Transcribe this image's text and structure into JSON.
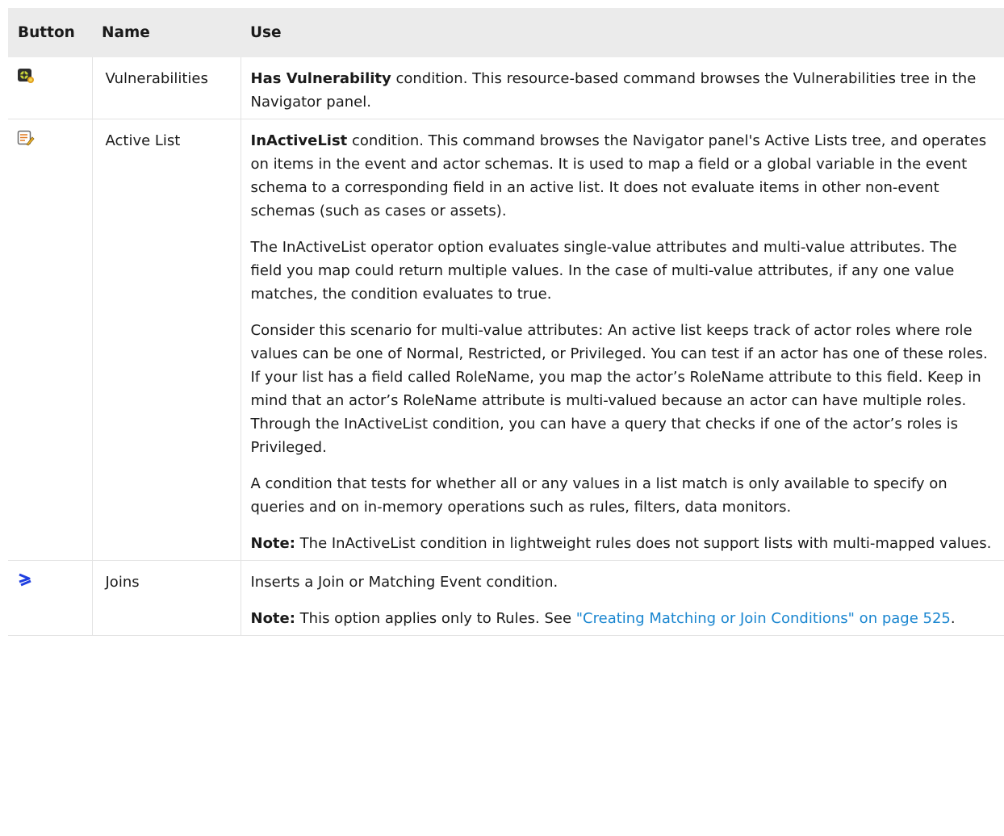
{
  "headers": {
    "button": "Button",
    "name": "Name",
    "use": "Use"
  },
  "rows": [
    {
      "icon": "vulnerability-icon",
      "name": "Vulnerabilities",
      "use": {
        "p1_bold": "Has Vulnerability",
        "p1_rest": " condition. This resource-based command browses the Vulnerabilities tree in the Navigator panel."
      }
    },
    {
      "icon": "active-list-icon",
      "name": "Active List",
      "use": {
        "p1_bold": "InActiveList",
        "p1_rest": " condition. This command browses the Navigator panel's Active Lists tree, and operates on items in the event and actor schemas. It is used to map a field or a global variable in the event schema to a corresponding field in an active list. It does not evaluate items in other non-event schemas (such as cases or assets).",
        "p2": "The InActiveList operator option evaluates single-value attributes and multi-value attributes. The field you map could return multiple values. In the case of multi-value attributes, if any one value matches, the condition evaluates to true.",
        "p3": "Consider this scenario for multi-value attributes: An active list keeps track of actor roles where role values can be one of Normal, Restricted, or Privileged. You can test if an actor has one of these roles. If your list has a field called RoleName, you map the actor’s RoleName attribute to this field. Keep in mind that an actor’s RoleName attribute is multi-valued because an actor can have multiple roles. Through the InActiveList condition, you can have a query that checks if one of the actor’s roles is Privileged.",
        "p4": "A condition that tests for whether all or any values in a list match is only available to specify on queries and on in-memory operations such as rules, filters, data monitors.",
        "note_label": "Note:",
        "note_text": " The InActiveList condition in lightweight rules does not support lists with multi-mapped values."
      }
    },
    {
      "icon": "joins-icon",
      "name": "Joins",
      "use": {
        "p1": "Inserts a Join or Matching Event condition.",
        "note_label": "Note:",
        "note_text": " This option applies only to Rules. See ",
        "link_text": "\"Creating Matching or Join Conditions\" on page 525",
        "note_end": "."
      }
    }
  ],
  "colors": {
    "link": "#1a86d0",
    "header_bg": "#ebebeb",
    "joins_icon": "#1f3fe0"
  }
}
